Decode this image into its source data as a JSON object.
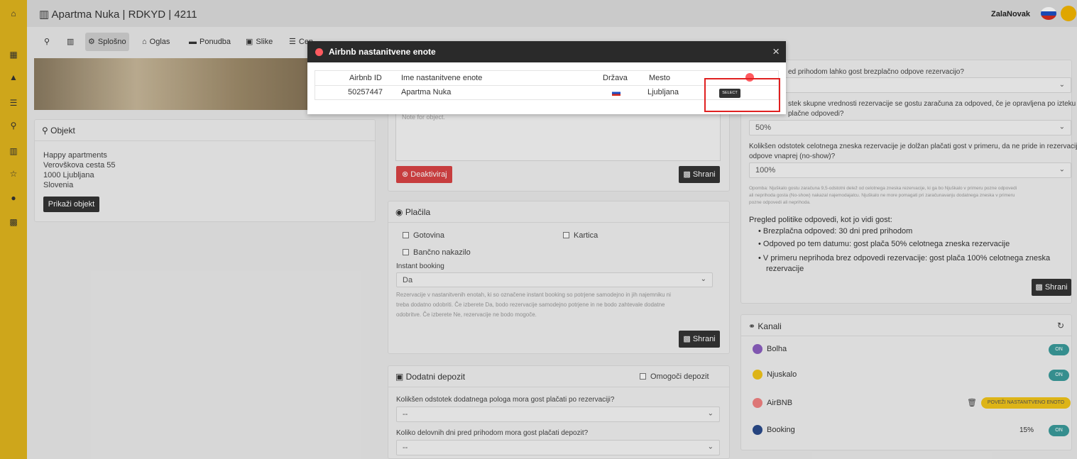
{
  "topbar": {
    "title": "Apartma Nuka | RDKYD | 4211",
    "user": "ZalaNovak"
  },
  "sidebar": {
    "icons": [
      "home-icon",
      "dashboard-icon",
      "ship-icon",
      "coins-icon",
      "location-icon",
      "building-icon",
      "star-icon",
      "info-icon",
      "document-icon"
    ]
  },
  "tabs": [
    {
      "label": ""
    },
    {
      "label": ""
    },
    {
      "label": "Splošno"
    },
    {
      "label": "Oglas"
    },
    {
      "label": "Ponudba"
    },
    {
      "label": "Slike"
    },
    {
      "label": "Cen"
    }
  ],
  "object_card": {
    "title": "Objekt",
    "name": "Happy apartments",
    "street": "Verovškova cesta 55",
    "city": "1000 Ljubljana",
    "country": "Slovenia",
    "show_button": "Prikaži objekt"
  },
  "middle": {
    "note_placeholder": "Note for object.",
    "deactivate": "Deaktiviraj",
    "save": "Shrani"
  },
  "payments": {
    "title": "Plačila",
    "cash": "Gotovina",
    "card": "Kartica",
    "bank": "Bančno nakazilo",
    "instant_label": "Instant booking",
    "instant_value": "Da",
    "help1": "Rezervacije v nastanitvenih enotah, ki so označene instant booking so potrjene samodejno in jih najemniku ni",
    "help2": "treba dodatno odobriti. Če izberete Da, bodo rezervacije samodejno potrjene in ne bodo zahtevale dodatne",
    "help3": "odobritve. Če izberete Ne, rezervacije ne bodo mogoče.",
    "save": "Shrani"
  },
  "deposit": {
    "title": "Dodatni depozit",
    "enable": "Omogoči depozit",
    "q1": "Kolikšen odstotek dodatnega pologa mora gost plačati po rezervaciji?",
    "q1_value": "--",
    "q2": "Koliko delovnih dni pred prihodom mora gost plačati depozit?",
    "q2_value": "--"
  },
  "policy": {
    "q1": "ed prihodom lahko gost brezplačno odpove rezervacijo?",
    "q2a": "stek skupne vrednosti rezervacije se gostu zaračuna za odpoved, če je opravljena po izteku",
    "q2b": "plačne odpovedi?",
    "q2_value": "50%",
    "q3a": "Kolikšen odstotek celotnega zneska rezervacije je dolžan plačati gost v primeru, da ne pride in rezervacije ne",
    "q3b": "odpove vnaprej (no-show)?",
    "q3_value": "100%",
    "note1": "Opomba: Njuškalo gostu zaračuna 9,5-odstotni delež od celotnega zneska rezervacije, ki ga bo Njuškalo v primeru pozne odpovedi",
    "note2": "ali neprihoda gosta (No-show) nakazal najemodajalcu. Njuškalo ne more pomagati pri zaračunavanju dodatnega zneska v primeru",
    "note3": "pozne odpovedi ali neprihoda.",
    "summary_title": "Pregled politike odpovedi, kot jo vidi gost:",
    "b1": "Brezplačna odpoved: 30 dni pred prihodom",
    "b2": "Odpoved po tem datumu: gost plača 50% celotnega zneska rezervacije",
    "b3a": "V primeru neprihoda brez odpovedi rezervacije: gost plača 100% celotnega zneska",
    "b3b": "rezervacije",
    "save": "Shrani"
  },
  "channels": {
    "title": "Kanali",
    "items": [
      {
        "name": "Bolha",
        "status": "ON",
        "extra": ""
      },
      {
        "name": "Njuskalo",
        "status": "ON",
        "extra": ""
      },
      {
        "name": "AirBNB",
        "status": "POVEŽI NASTANITVENO ENOTO",
        "extra": ""
      },
      {
        "name": "Booking",
        "status": "ON",
        "extra": "15%"
      }
    ],
    "colors": {
      "on": "#3a9b9b",
      "connect": "#f0c419"
    }
  },
  "modal": {
    "title": "Airbnb nastanitvene enote",
    "headers": [
      "Airbnb ID",
      "Ime nastanitvene enote",
      "Država",
      "Mesto",
      ""
    ],
    "row": {
      "id": "50257447",
      "name": "Apartma Nuka",
      "city": "Ljubljana",
      "action": "SELECT"
    }
  }
}
